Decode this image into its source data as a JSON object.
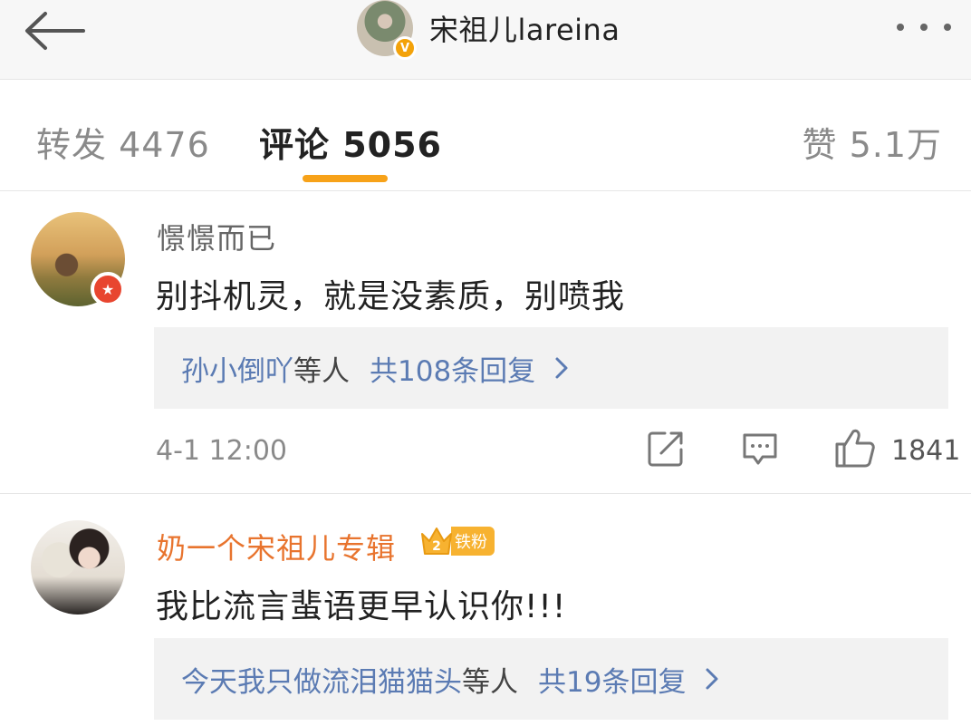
{
  "header": {
    "title": "宋祖儿lareina",
    "verified_badge": "V",
    "back_icon": "back-arrow-icon",
    "more_icon": "more-dots-icon"
  },
  "tabs": [
    {
      "label": "转发 4476",
      "active": false
    },
    {
      "label": "评论 5056",
      "active": true
    },
    {
      "label": "赞 5.1万",
      "active": false
    }
  ],
  "accent_color": "#f7a219",
  "comments": [
    {
      "username": "憬憬而已",
      "text": "别抖机灵，就是没素质，别喷我",
      "reply_names": "孙小倒吖",
      "reply_suffix": "等人",
      "reply_count": "共108条回复",
      "time": "4-1 12:00",
      "likes": "1841"
    },
    {
      "username": "奶一个宋祖儿专辑",
      "fan_badge": "铁粉",
      "fan_level": "2",
      "text": "我比流言蜚语更早认识你!!!",
      "reply_names": "今天我只做流泪猫猫头",
      "reply_suffix": "等人",
      "reply_count": "共19条回复"
    }
  ]
}
